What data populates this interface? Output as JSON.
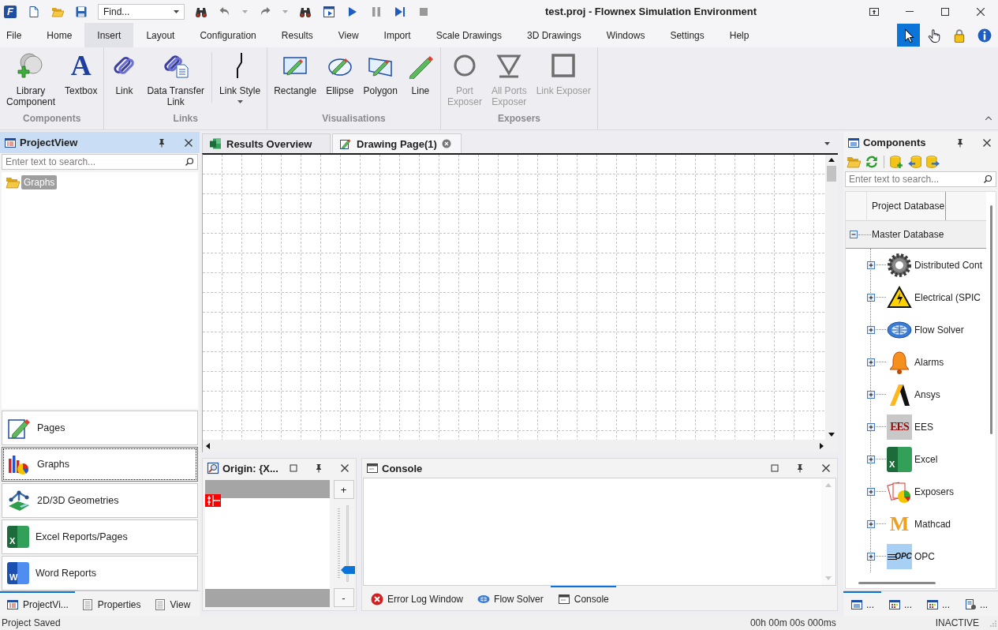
{
  "title_bar": {
    "logo": "F",
    "find_field": {
      "value": "Find..."
    },
    "title": "test.proj - Flownex Simulation Environment"
  },
  "menu": [
    {
      "label": "File",
      "selected": false
    },
    {
      "label": "Home",
      "selected": false
    },
    {
      "label": "Insert",
      "selected": true
    },
    {
      "label": "Layout",
      "selected": false
    },
    {
      "label": "Configuration",
      "selected": false
    },
    {
      "label": "Results",
      "selected": false
    },
    {
      "label": "View",
      "selected": false
    },
    {
      "label": "Import",
      "selected": false
    },
    {
      "label": "Scale Drawings",
      "selected": false
    },
    {
      "label": "3D Drawings",
      "selected": false
    },
    {
      "label": "Windows",
      "selected": false
    },
    {
      "label": "Settings",
      "selected": false
    },
    {
      "label": "Help",
      "selected": false
    }
  ],
  "mode_tools": [
    {
      "kind": "pointer",
      "selected": true
    },
    {
      "kind": "hand",
      "selected": false
    },
    {
      "kind": "lock",
      "selected": false
    },
    {
      "kind": "info",
      "selected": false
    }
  ],
  "ribbon": {
    "groups": [
      {
        "label": "Components",
        "buttons": [
          {
            "kind": "library",
            "lines": [
              "Library",
              "Component"
            ],
            "disabled": false
          },
          {
            "kind": "textbox",
            "icon_text": "A",
            "lines": [
              "Textbox"
            ],
            "disabled": false
          }
        ]
      },
      {
        "label": "Links",
        "buttons": [
          {
            "kind": "link",
            "lines": [
              "Link"
            ],
            "disabled": false
          },
          {
            "kind": "data_link",
            "lines": [
              "Data Transfer",
              "Link"
            ],
            "disabled": false
          },
          {
            "kind": "link_style",
            "lines": [
              "Link Style"
            ],
            "disabled": false,
            "dropdown": true
          }
        ]
      },
      {
        "label": "Visualisations",
        "buttons": [
          {
            "kind": "rectangle",
            "lines": [
              "Rectangle"
            ],
            "disabled": false
          },
          {
            "kind": "ellipse",
            "lines": [
              "Ellipse"
            ],
            "disabled": false
          },
          {
            "kind": "polygon",
            "lines": [
              "Polygon"
            ],
            "disabled": false
          },
          {
            "kind": "line",
            "lines": [
              "Line"
            ],
            "disabled": false
          }
        ]
      },
      {
        "label": "Exposers",
        "buttons": [
          {
            "kind": "port_exposer",
            "lines": [
              "Port",
              "Exposer"
            ],
            "disabled": true
          },
          {
            "kind": "all_ports_exposer",
            "lines": [
              "All Ports",
              "Exposer"
            ],
            "disabled": true
          },
          {
            "kind": "link_exposer",
            "lines": [
              "Link Exposer"
            ],
            "disabled": true
          }
        ]
      }
    ]
  },
  "project_view": {
    "title": "ProjectView",
    "search": {
      "placeholder": "Enter text to search..."
    },
    "tree": [
      {
        "label": "Graphs",
        "selected": true
      }
    ],
    "nav_buttons": [
      {
        "kind": "pages",
        "label": "Pages",
        "selected": false
      },
      {
        "kind": "graphs",
        "label": "Graphs",
        "selected": true
      },
      {
        "kind": "geometries",
        "label": "2D/3D Geometries",
        "selected": false
      },
      {
        "kind": "excel",
        "icon_text": "X",
        "label": "Excel Reports/Pages",
        "selected": false
      },
      {
        "kind": "word",
        "icon_text": "W",
        "label": "Word Reports",
        "selected": false
      }
    ],
    "tabs": [
      {
        "kind": "project",
        "label": "ProjectVi...",
        "selected": true
      },
      {
        "kind": "list",
        "label": "Properties",
        "selected": false
      },
      {
        "kind": "list",
        "label": "View",
        "selected": false
      }
    ]
  },
  "document_tabs": [
    {
      "kind": "excel",
      "label": "Results Overview",
      "selected": false
    },
    {
      "kind": "drawing",
      "label": "Drawing Page(1)",
      "selected": true
    }
  ],
  "origin_panel": {
    "title": "Origin: {X...",
    "zoom_in": "+",
    "zoom_out": "-",
    "zoom_slider": {
      "level": 0.15
    }
  },
  "console_panel": {
    "title": "Console",
    "tabs": [
      {
        "kind": "error",
        "label": "Error Log Window",
        "selected": false
      },
      {
        "kind": "solver",
        "label": "Flow Solver",
        "selected": false
      },
      {
        "kind": "console",
        "label": "Console",
        "selected": true
      }
    ]
  },
  "components_panel": {
    "title": "Components",
    "search": {
      "placeholder": "Enter text to search..."
    },
    "column_header": "Project Database",
    "tree": [
      {
        "label": "Master Database",
        "expanded": true,
        "children": [
          {
            "kind": "gear",
            "label": "Distributed Cont",
            "expanded": false
          },
          {
            "kind": "warning",
            "label": "Electrical (SPIC",
            "expanded": false
          },
          {
            "kind": "solver",
            "label": "Flow Solver",
            "expanded": false
          },
          {
            "kind": "bell",
            "label": "Alarms",
            "expanded": false
          },
          {
            "kind": "ansys",
            "label": "Ansys",
            "expanded": false
          },
          {
            "kind": "ees",
            "icon_text": "EES",
            "label": "EES",
            "expanded": false
          },
          {
            "kind": "excel",
            "icon_text": "X",
            "label": "Excel",
            "expanded": false
          },
          {
            "kind": "exposers",
            "label": "Exposers",
            "expanded": false
          },
          {
            "kind": "mathcad",
            "icon_text": "M",
            "label": "Mathcad",
            "expanded": false
          },
          {
            "kind": "opc",
            "icon_text": "OPC",
            "label": "OPC",
            "expanded": false
          }
        ]
      }
    ],
    "tabs": [
      {
        "kind": "project",
        "label": "...",
        "selected": true
      },
      {
        "kind": "palette",
        "label": "...",
        "selected": false
      },
      {
        "kind": "palette",
        "label": "...",
        "selected": false
      },
      {
        "kind": "document",
        "label": "...",
        "selected": false
      }
    ]
  },
  "status_bar": {
    "message": "Project Saved",
    "timer": "00h 00m 00s 000ms",
    "state": "INACTIVE"
  }
}
